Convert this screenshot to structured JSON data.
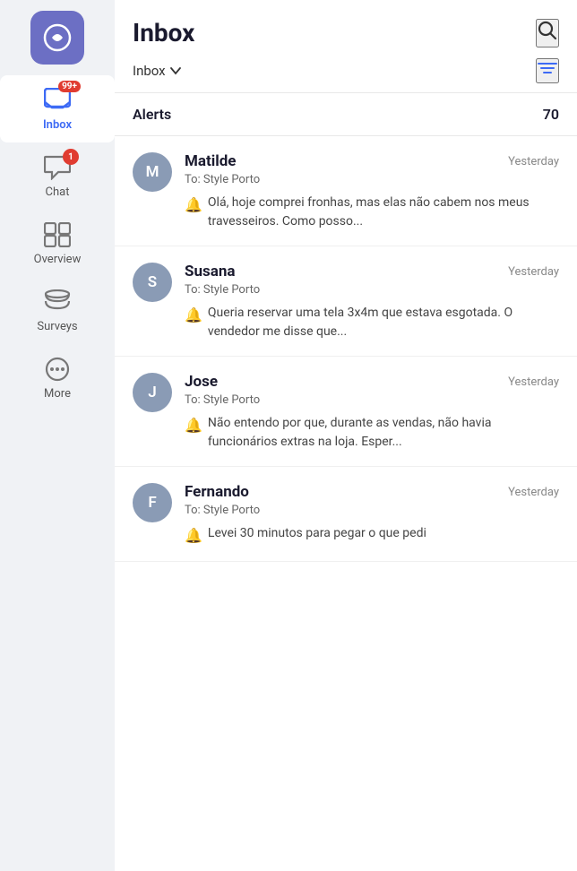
{
  "app": {
    "logo_alt": "App logo"
  },
  "sidebar": {
    "items": [
      {
        "id": "inbox",
        "label": "Inbox",
        "badge": "99+",
        "active": true
      },
      {
        "id": "chat",
        "label": "Chat",
        "badge": "1",
        "active": false
      },
      {
        "id": "overview",
        "label": "Overview",
        "badge": null,
        "active": false
      },
      {
        "id": "surveys",
        "label": "Surveys",
        "badge": null,
        "active": false
      },
      {
        "id": "more",
        "label": "More",
        "badge": null,
        "active": false
      }
    ]
  },
  "header": {
    "title": "Inbox",
    "dropdown_label": "Inbox",
    "chevron": "▾"
  },
  "alerts": {
    "label": "Alerts",
    "count": "70"
  },
  "conversations": [
    {
      "id": 1,
      "avatar_letter": "M",
      "name": "Matilde",
      "to": "To: Style Porto",
      "time": "Yesterday",
      "preview": "Olá, hoje comprei fronhas, mas elas não cabem nos meus travesseiros. Como posso..."
    },
    {
      "id": 2,
      "avatar_letter": "S",
      "name": "Susana",
      "to": "To: Style Porto",
      "time": "Yesterday",
      "preview": "Queria reservar uma tela 3x4m que estava esgotada. O vendedor me disse que..."
    },
    {
      "id": 3,
      "avatar_letter": "J",
      "name": "Jose",
      "to": "To: Style Porto",
      "time": "Yesterday",
      "preview": "Não entendo por que, durante as vendas, não havia funcionários extras na loja. Esper..."
    },
    {
      "id": 4,
      "avatar_letter": "F",
      "name": "Fernando",
      "to": "To: Style Porto",
      "time": "Yesterday",
      "preview": "Levei 30 minutos para pegar o que pedi"
    }
  ]
}
